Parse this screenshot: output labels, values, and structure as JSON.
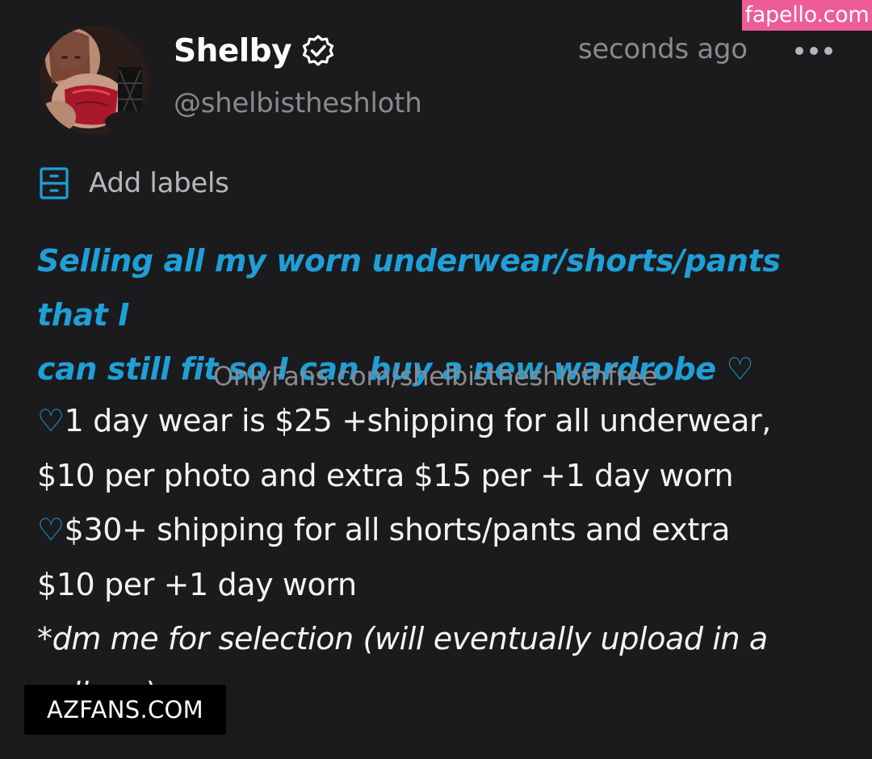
{
  "watermarks": {
    "top_right": "fapello.com",
    "bottom_left": "AZFANS.COM"
  },
  "post": {
    "author": {
      "display_name": "Shelby",
      "handle": "@shelbistheshloth",
      "verified_icon": "verified-badge-icon"
    },
    "timestamp": "seconds ago",
    "more_icon": "more-horizontal-icon",
    "labels": {
      "icon": "labels-icon",
      "text": "Add labels"
    },
    "headline": {
      "line1": "Selling all my worn underwear/shorts/pants that I",
      "line2": "can still fit so I can buy a new wardrobe ",
      "heart": "♡"
    },
    "promo_link": "OnlyFans.com/shelbistheshlothfree",
    "body": {
      "heart": "♡",
      "line1": "1 day wear is $25 +shipping for all underwear,",
      "line2": "$10 per photo and extra $15 per +1 day worn",
      "line3": "$30+ shipping for all shorts/pants and extra",
      "line4": "$10 per +1 day worn",
      "line5": "*dm me for selection (will eventually upload in a",
      "line6": "collage)"
    }
  },
  "colors": {
    "background": "#1b1b1d",
    "accent_blue": "#1f9fd8",
    "muted_text": "#8a8a8e",
    "watermark_pink": "#ee5c97"
  }
}
